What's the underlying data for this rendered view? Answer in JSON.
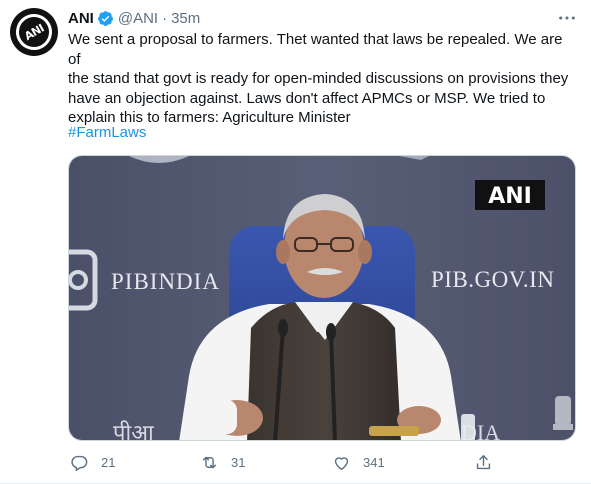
{
  "tweet": {
    "author_name": "ANI",
    "handle": "@ANI",
    "separator": "·",
    "time": "35m",
    "avatar_text": "ANI",
    "text_lines": [
      "We sent a proposal to farmers. Thet wanted that laws be repealed. We are of",
      "the stand that govt is ready for open-minded discussions on provisions they",
      "have an objection against. Laws don't affect APMCs or MSP. We tried to",
      "explain this to farmers: Agriculture Minister"
    ],
    "hashtag": "#FarmLaws"
  },
  "media": {
    "watermark": "ANI",
    "backdrop_left": "PIBINDIA",
    "backdrop_right": "PIB.GOV.IN",
    "backdrop_bottom_left": "पीआ",
    "backdrop_bottom_right": "DIA"
  },
  "actions": {
    "reply_count": "21",
    "retweet_count": "31",
    "like_count": "341"
  },
  "colors": {
    "accent": "#1b95e0",
    "muted": "#5b7083",
    "verified": "#1da1f2"
  }
}
